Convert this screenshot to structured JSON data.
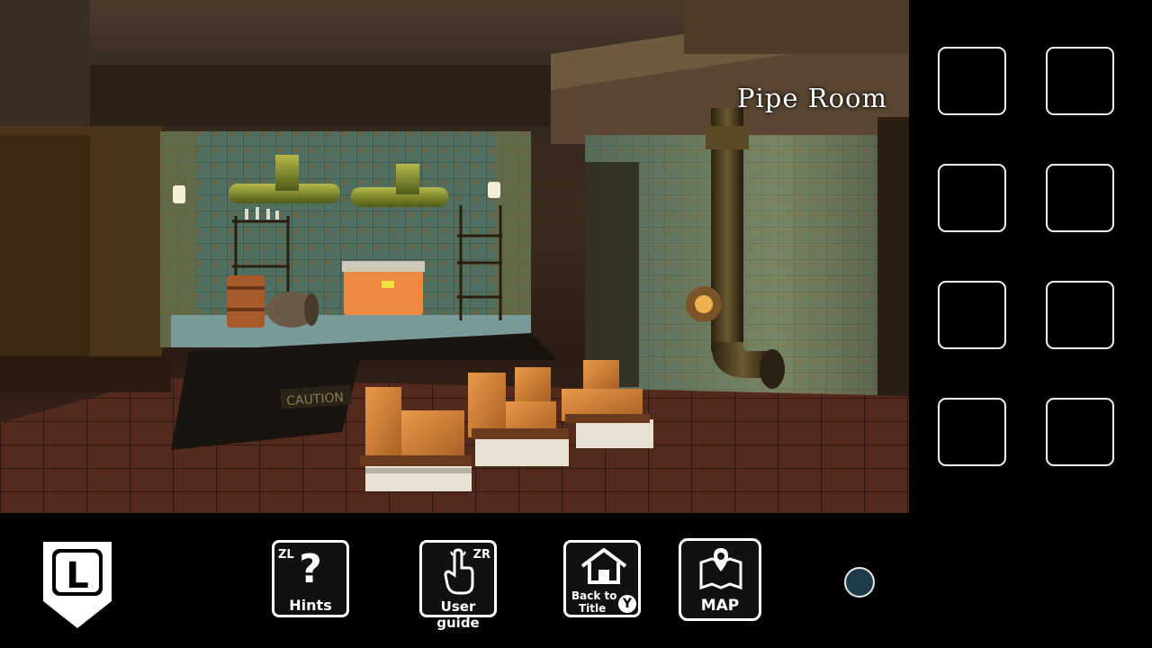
{
  "scene": {
    "room_name": "Pipe Room",
    "caution_sign": "CAUTION"
  },
  "inventory": {
    "slots": [
      "",
      "",
      "",
      "",
      "",
      "",
      "",
      ""
    ]
  },
  "controls": {
    "l_button_label": "L",
    "hints": {
      "badge": "ZL",
      "symbol": "?",
      "label": "Hints"
    },
    "user_guide": {
      "badge": "ZR",
      "label": "User guide"
    },
    "back_to_title": {
      "label_line1": "Back to",
      "label_line2": "Title",
      "badge": "Y"
    },
    "map": {
      "label": "MAP"
    }
  },
  "colors": {
    "slot_border": "#f2f2f2",
    "status_dot": "#1d3b4a"
  }
}
